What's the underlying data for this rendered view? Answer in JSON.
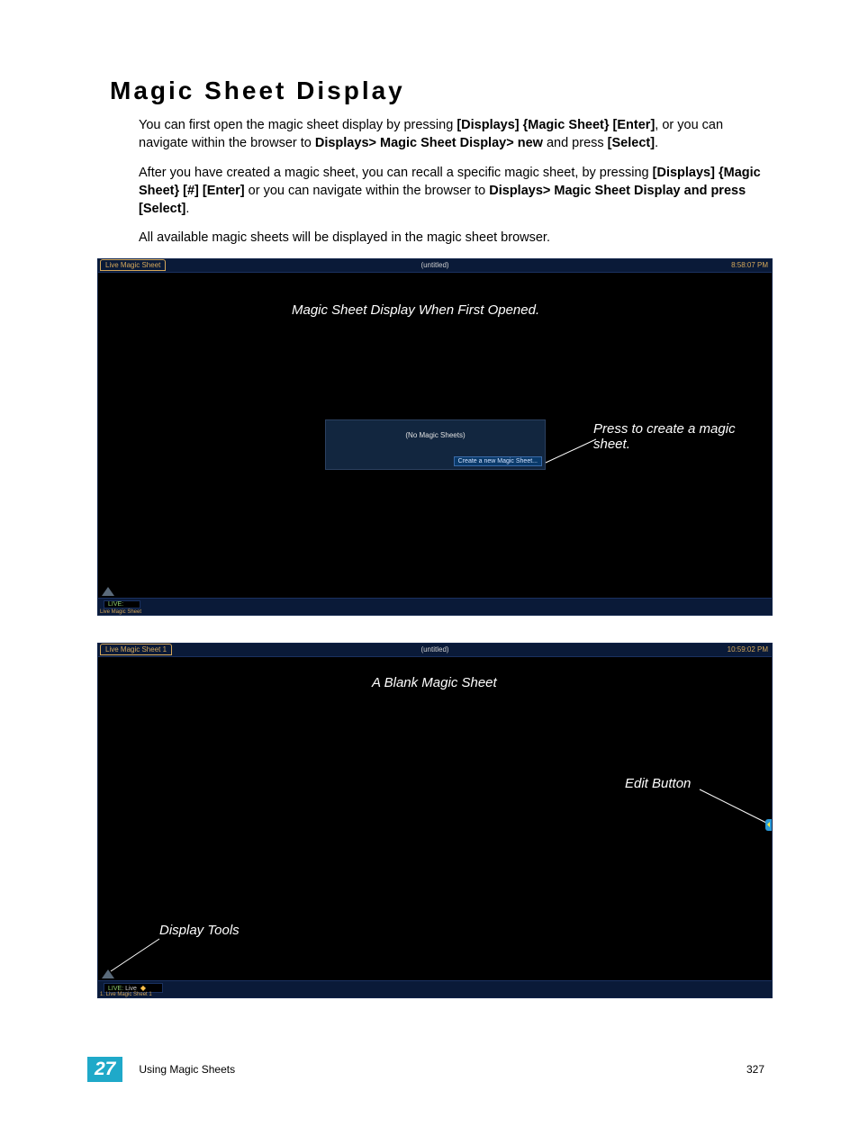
{
  "heading": "Magic Sheet Display",
  "para1_a": "You can first open the magic sheet display by pressing ",
  "para1_b": "[Displays] {Magic Sheet} [Enter]",
  "para1_c": ", or you can navigate within the browser to ",
  "para1_d": "Displays> Magic Sheet Display> new",
  "para1_e": " and press ",
  "para1_f": "[Select]",
  "para1_g": ".",
  "para2_a": "After you have created a magic sheet, you can recall a specific magic sheet, by pressing ",
  "para2_b": "[Displays] {Magic Sheet} [#] [Enter]",
  "para2_c": " or you can navigate within the browser to ",
  "para2_d": "Displays> Magic Sheet Display and press [Select]",
  "para2_e": ".",
  "para3": "All available magic sheets will be displayed in the magic sheet browser.",
  "shot1": {
    "tab": "Live Magic Sheet",
    "title": "(untitled)",
    "clock": "8:58:07 PM",
    "caption": "Magic Sheet Display When First Opened.",
    "dlg_text": "(No Magic Sheets)",
    "dlg_btn": "Create a new Magic Sheet...",
    "annot": "Press to create a magic sheet.",
    "status_live": "LIVE:",
    "status_sub": "Live Magic Sheet"
  },
  "shot2": {
    "tab": "Live Magic Sheet 1",
    "title": "(untitled)",
    "clock": "10:59:02 PM",
    "caption": "A Blank Magic Sheet",
    "annot_edit": "Edit Button",
    "annot_tools": "Display Tools",
    "status_live_a": "LIVE:",
    "status_live_b": "Live",
    "status_sub": "1. Live Magic Sheet 1"
  },
  "footer": {
    "chapter_num": "27",
    "chapter_label": "Using Magic Sheets",
    "page_num": "327"
  }
}
